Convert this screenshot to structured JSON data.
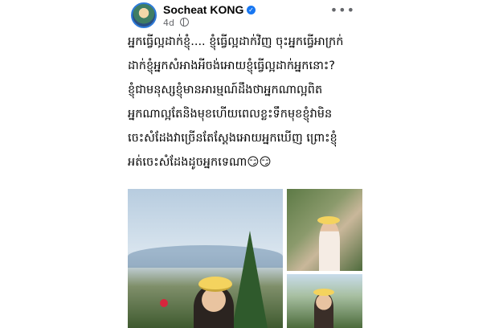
{
  "post": {
    "author": "Socheat KONG",
    "time": "4d",
    "text_lines": [
      "អ្នកធ្វើល្អដាក់ខ្ញុំ.... ខ្ញុំធ្វើល្អដាក់វិញ ចុះអ្នកធ្វើអាក្រក់",
      "ដាក់ខ្ញុំអ្នកសំអាងអីចង់អោយខ្ញុំធ្វើល្អដាក់អ្នកនោះ?",
      "ខ្ញុំជាមនុស្សខ្ញុំមានអារម្មណ៍ដឹងថាអ្នកណាល្អពិត",
      "អ្នកណាល្អតែនិងមុខហើយពេលខ្លះទឹកមុខខ្ញុំវាមិន",
      "ចេះសំដែងវាច្រើនតែស្តែងអោយអ្នកឃើញ ព្រោះខ្ញុំ",
      "អត់ចេះសំដែងដូចអ្នកទេណា😏😏"
    ]
  },
  "icons": {
    "verified": "verified-badge-icon",
    "privacy": "globe-icon",
    "more": "more-options-icon"
  },
  "colors": {
    "verified": "#1877f2",
    "meta_text": "#65676b",
    "hat": "#f4d35e"
  }
}
